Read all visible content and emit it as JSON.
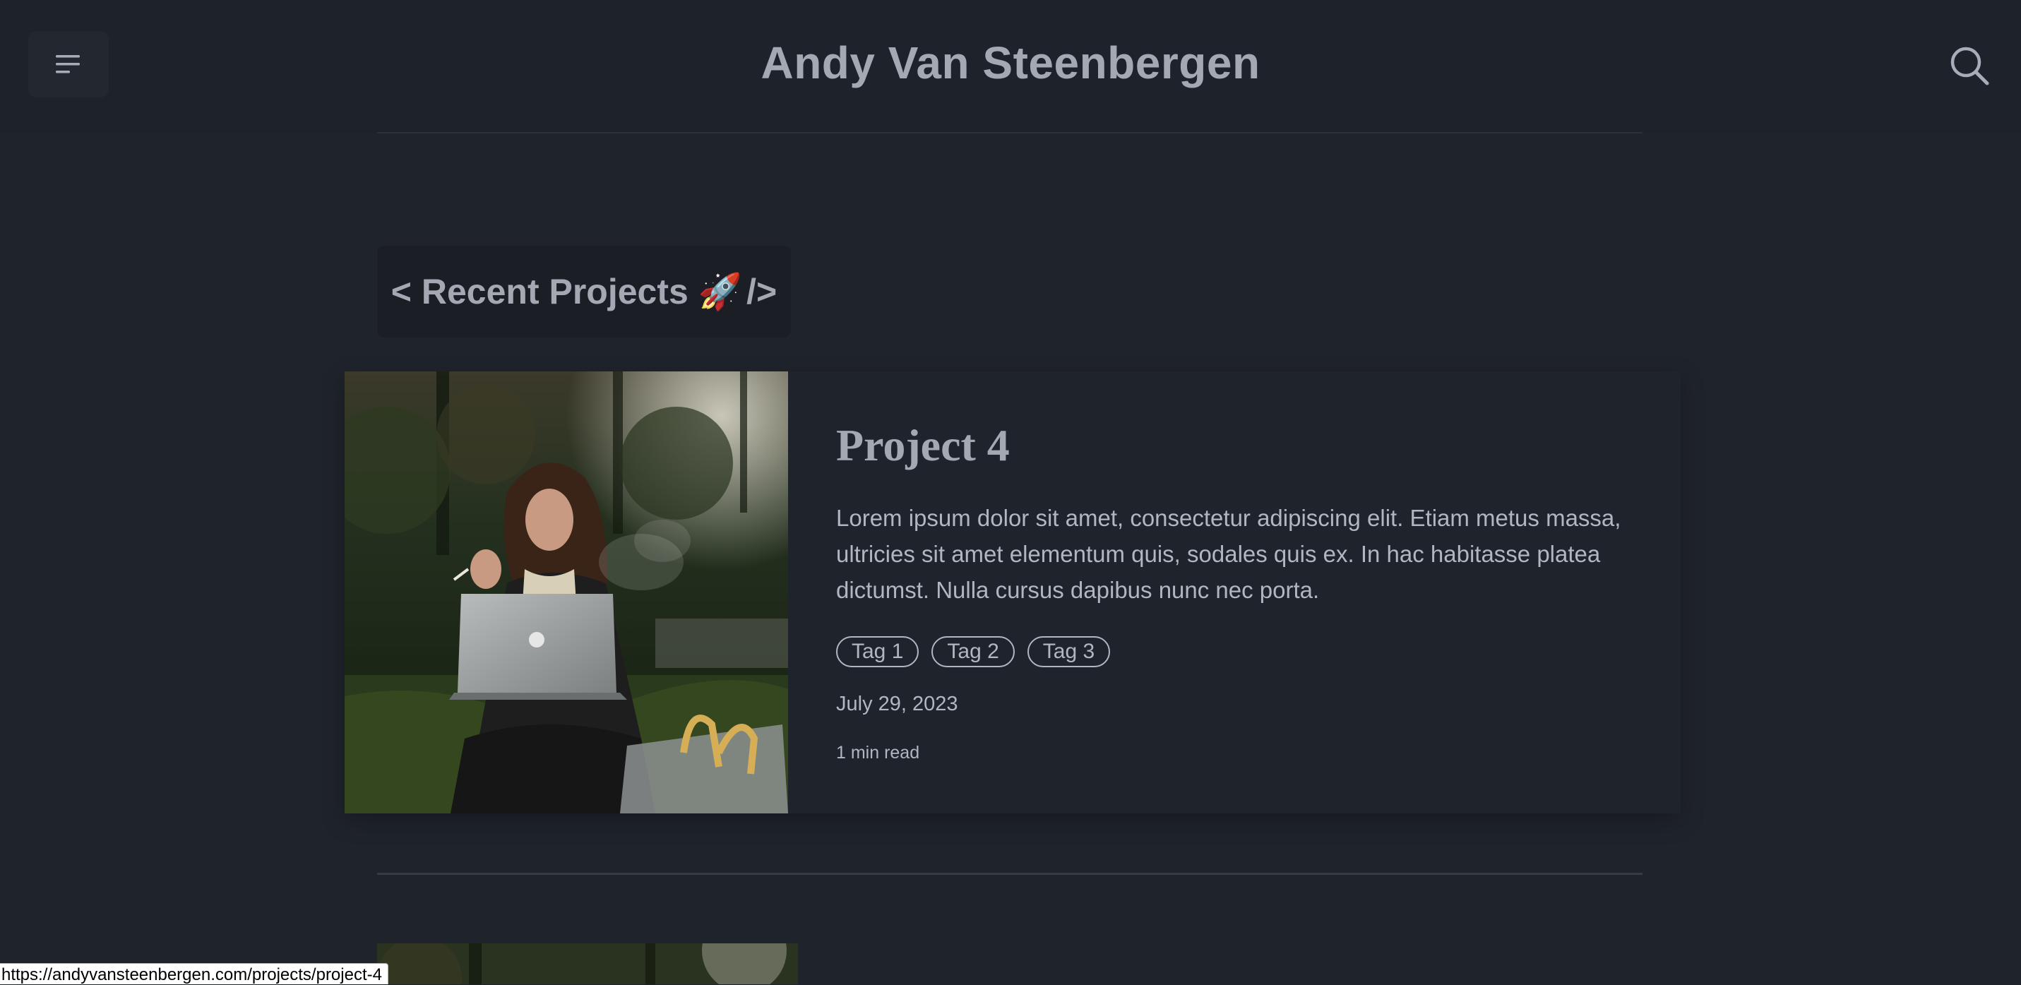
{
  "header": {
    "site_title": "Andy Van Steenbergen",
    "menu_icon": "menu-icon",
    "search_icon": "search-icon"
  },
  "section": {
    "heading_prefix": "< Recent Projects",
    "heading_emoji": "🚀",
    "heading_suffix": "/>"
  },
  "projects": [
    {
      "title": "Project 4",
      "excerpt": "Lorem ipsum dolor sit amet, consectetur adipiscing elit. Etiam metus massa, ultricies sit amet elementum quis, sodales quis ex. In hac habitasse platea dictumst. Nulla cursus dapibus nunc nec porta.",
      "tags": [
        "Tag 1",
        "Tag 2",
        "Tag 3"
      ],
      "date": "July 29, 2023",
      "read_time": "1 min read"
    }
  ],
  "status_bar": {
    "url": "https://andyvansteenbergen.com/projects/project-4"
  },
  "colors": {
    "background": "#1f232b",
    "text": "#a3a8b3"
  }
}
